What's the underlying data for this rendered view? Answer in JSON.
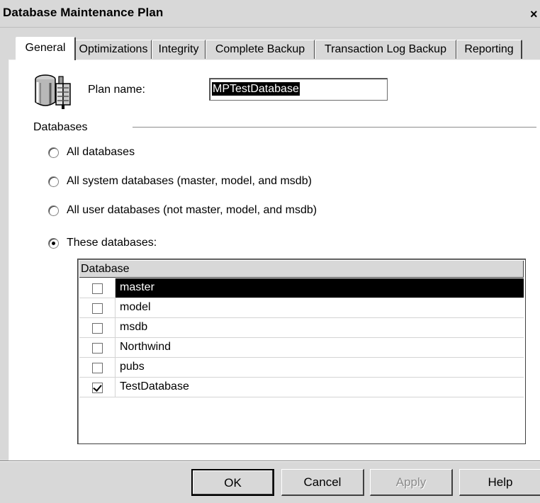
{
  "window": {
    "title": "Database Maintenance Plan",
    "close_glyph": "×"
  },
  "tabs": [
    {
      "label": "General",
      "active": true
    },
    {
      "label": "Optimizations",
      "active": false
    },
    {
      "label": "Integrity",
      "active": false
    },
    {
      "label": "Complete Backup",
      "active": false
    },
    {
      "label": "Transaction Log Backup",
      "active": false
    },
    {
      "label": "Reporting",
      "active": false
    }
  ],
  "plan": {
    "icon": "database-server-icon",
    "label": "Plan name:",
    "value": "MPTestDatabase"
  },
  "databases_group": {
    "label": "Databases",
    "options": [
      {
        "label": "All databases",
        "selected": false
      },
      {
        "label": "All system databases (master, model, and msdb)",
        "selected": false
      },
      {
        "label": "All user databases (not master, model, and msdb)",
        "selected": false
      },
      {
        "label": "These databases:",
        "selected": true
      }
    ]
  },
  "database_list": {
    "header": "Database",
    "rows": [
      {
        "name": "master",
        "checked": false,
        "selected": true
      },
      {
        "name": "model",
        "checked": false,
        "selected": false
      },
      {
        "name": "msdb",
        "checked": false,
        "selected": false
      },
      {
        "name": "Northwind",
        "checked": false,
        "selected": false
      },
      {
        "name": "pubs",
        "checked": false,
        "selected": false
      },
      {
        "name": "TestDatabase",
        "checked": true,
        "selected": false
      }
    ]
  },
  "buttons": {
    "ok": "OK",
    "cancel": "Cancel",
    "apply": "Apply",
    "help": "Help"
  }
}
